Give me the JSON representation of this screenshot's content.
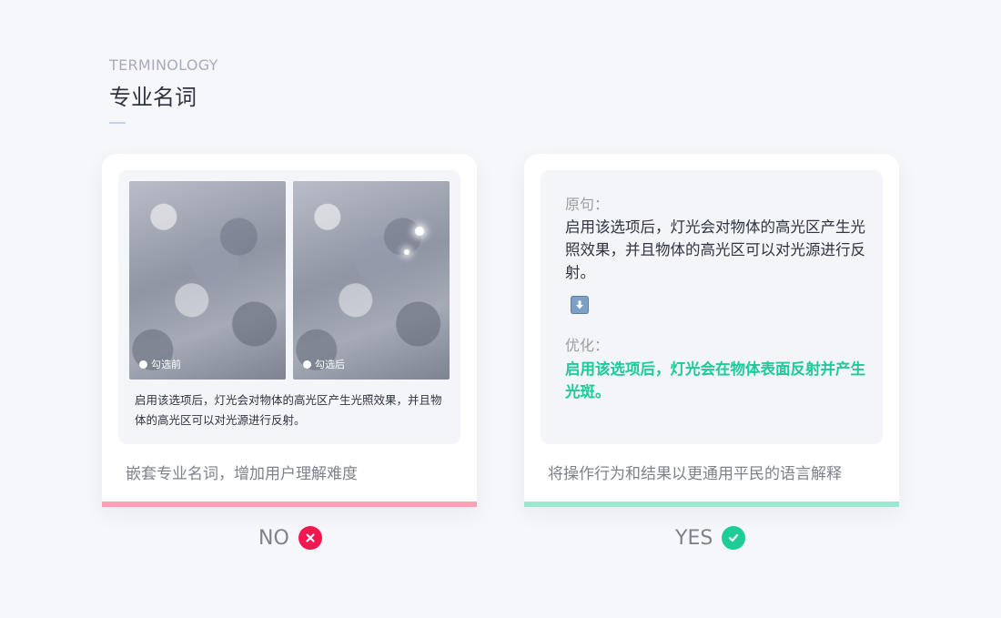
{
  "header": {
    "eyebrow": "TERMINOLOGY",
    "title": "专业名词"
  },
  "bad_card": {
    "image_before_label": "勾选前",
    "image_after_label": "勾选后",
    "inner_text": "启用该选项后，灯光会对物体的高光区产生光照效果，并且物体的高光区可以对光源进行反射。",
    "caption": "嵌套专业名词，增加用户理解难度",
    "accent_color": "#f7a3b6"
  },
  "good_card": {
    "original_label": "原句：",
    "original_text": "启用该选项后，灯光会对物体的高光区产生光照效果，并且物体的高光区可以对光源进行反射。",
    "arrow_icon": "arrow-down-icon",
    "optimized_label": "优化：",
    "optimized_text": "启用该选项后，灯光会在物体表面反射并产生光斑。",
    "caption": "将操作行为和结果以更通用平民的语言解释",
    "accent_color": "#9ae8cf",
    "highlight_color": "#1ec99a"
  },
  "verdicts": {
    "no_label": "NO",
    "no_icon": "close-icon",
    "no_color": "#f0184f",
    "yes_label": "YES",
    "yes_icon": "check-icon",
    "yes_color": "#1ecc95"
  }
}
